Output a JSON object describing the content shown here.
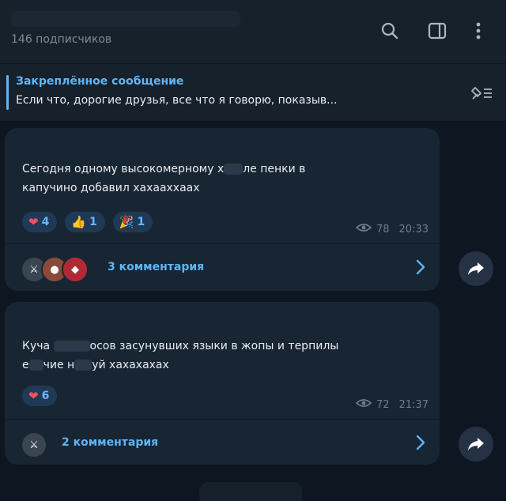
{
  "header": {
    "subscribers": "146 подписчиков"
  },
  "pinned": {
    "title": "Закреплённое сообщение",
    "text": "Если что, дорогие друзья, все что я говорю, показыв..."
  },
  "posts": [
    {
      "text_line1_a": "Сегодня одному высокомерному х",
      "text_line1_b": "ле пенки в",
      "text_line2": "капучино добавил хахааххаах",
      "reactions": [
        {
          "icon": "heart",
          "emoji": "❤",
          "count": "4"
        },
        {
          "icon": "thumbs-up",
          "emoji": "👍",
          "count": "1"
        },
        {
          "icon": "party",
          "emoji": "🎉",
          "count": "1"
        }
      ],
      "views": "78",
      "time": "20:33",
      "comments_label": "3 комментария"
    },
    {
      "text_line1_a": "Куча",
      "text_line1_b": "осов засунувших языки в жопы и терпилы",
      "text_line2_a": "е",
      "text_line2_b": "чие н",
      "text_line2_c": "уй хахахахах",
      "reactions": [
        {
          "icon": "heart",
          "emoji": "❤",
          "count": "6"
        }
      ],
      "views": "72",
      "time": "21:37",
      "comments_label": "2 комментария"
    }
  ],
  "colors": {
    "accent": "#5eb5f7",
    "background": "#0e1621",
    "bubble": "#182533"
  }
}
